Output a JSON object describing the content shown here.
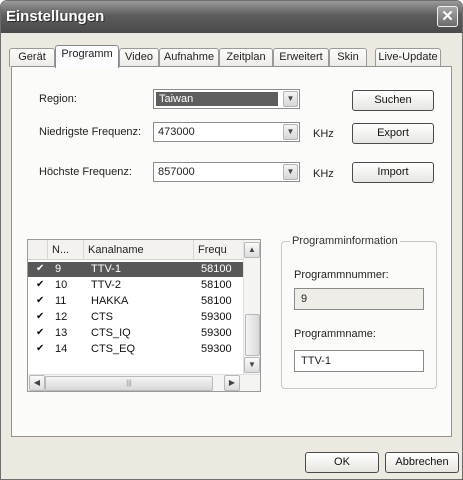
{
  "window": {
    "title": "Einstellungen",
    "close_glyph": "✕"
  },
  "tabs": [
    {
      "label": "Gerät"
    },
    {
      "label": "Programm",
      "active": true
    },
    {
      "label": "Video"
    },
    {
      "label": "Aufnahme"
    },
    {
      "label": "Zeitplan"
    },
    {
      "label": "Erweitert"
    },
    {
      "label": "Skin"
    },
    {
      "label": "Live-Update"
    }
  ],
  "form": {
    "region_label": "Region:",
    "region_value": "Taiwan",
    "low_freq_label": "Niedrigste Frequenz:",
    "low_freq_value": "473000",
    "high_freq_label": "Höchste Frequenz:",
    "high_freq_value": "857000",
    "unit": "KHz"
  },
  "buttons": {
    "search": "Suchen",
    "export": "Export",
    "import": "Import",
    "ok": "OK",
    "cancel": "Abbrechen"
  },
  "channel_list": {
    "columns": [
      "N...",
      "Kanalname",
      "Frequ"
    ],
    "rows": [
      {
        "checked": "✔",
        "n": "9",
        "name": "TTV-1",
        "freq": "58100",
        "selected": true
      },
      {
        "checked": "✔",
        "n": "10",
        "name": "TTV-2",
        "freq": "58100"
      },
      {
        "checked": "✔",
        "n": "11",
        "name": "HAKKA",
        "freq": "58100"
      },
      {
        "checked": "✔",
        "n": "12",
        "name": "CTS",
        "freq": "59300"
      },
      {
        "checked": "✔",
        "n": "13",
        "name": "CTS_IQ",
        "freq": "59300"
      },
      {
        "checked": "✔",
        "n": "14",
        "name": "CTS_EQ",
        "freq": "59300"
      }
    ]
  },
  "program_info": {
    "group_title": "Programminformation",
    "number_label": "Programmnummer:",
    "number_value": "9",
    "name_label": "Programmname:",
    "name_value": "TTV-1"
  },
  "icons": {
    "dropdown": "chevron-down-icon",
    "scroll_up": "chevron-up-icon",
    "scroll_left": "chevron-left-icon",
    "scroll_right": "chevron-right-icon",
    "check": "check-icon"
  }
}
